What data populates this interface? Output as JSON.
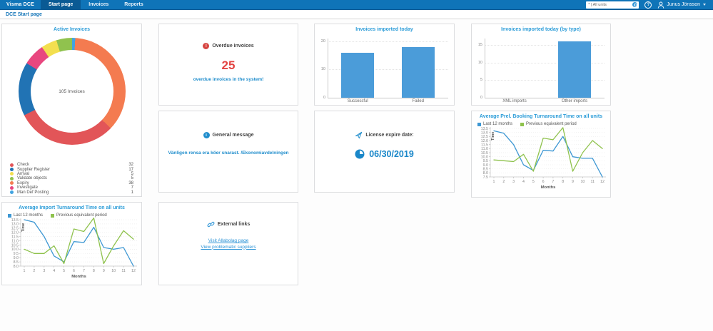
{
  "nav": {
    "brand": "Visma DCE",
    "items": [
      {
        "label": "Start page",
        "active": true
      },
      {
        "label": "Invoices",
        "active": false
      },
      {
        "label": "Reports",
        "active": false
      }
    ],
    "unit_selector": "* | All units",
    "user": "Junus Jönsson"
  },
  "breadcrumb": "DCE Start page",
  "cards": {
    "overdue": {
      "title": "Overdue invoices",
      "count": "25",
      "message": "overdue invoices in the system!"
    },
    "general_message": {
      "title": "General message",
      "message": "Vänligen rensa era köer snarast. /Ekonomiavdelningen"
    },
    "license": {
      "title": "License expire date:",
      "date": "06/30/2019"
    },
    "external_links": {
      "title": "External links",
      "links": [
        "Visit Allabolag page",
        "View problematic suppliers"
      ]
    }
  },
  "colors": {
    "navbar": "#0f74b8",
    "accent_blue": "#2b9cd8",
    "alert_red": "#e34543",
    "bar_fill": "#4b9cd9",
    "line_blue": "#3d97d3",
    "line_green": "#8fc24d"
  },
  "chart_data": [
    {
      "type": "pie",
      "title": "Active Invoices",
      "center_label": "105 Invoices",
      "total": 105,
      "segments": [
        {
          "label": "Check",
          "value": 32,
          "color": "#e25558"
        },
        {
          "label": "Supplier Register",
          "value": 17,
          "color": "#2173b4"
        },
        {
          "label": "Arrival",
          "value": 5,
          "color": "#f3df4f"
        },
        {
          "label": "Validate objects",
          "value": 5,
          "color": "#90c24e"
        },
        {
          "label": "Expiry",
          "value": 38,
          "color": "#f47b50"
        },
        {
          "label": "Investigate",
          "value": 7,
          "color": "#e8477f"
        },
        {
          "label": "Man Def Posting",
          "value": 1,
          "color": "#41a3e0"
        }
      ],
      "clockwise_order": [
        6,
        4,
        0,
        1,
        5,
        2,
        3
      ]
    },
    {
      "type": "bar",
      "title": "Invoices imported today",
      "categories": [
        "Successful",
        "Failed"
      ],
      "values": [
        16,
        18
      ],
      "y_ticks": [
        0,
        10,
        20
      ],
      "ylim": [
        0,
        21
      ]
    },
    {
      "type": "bar",
      "title": "Invoices imported today (by type)",
      "categories": [
        "XML imports",
        "Other imports"
      ],
      "values": [
        0,
        16
      ],
      "y_ticks": [
        0,
        5,
        10,
        15
      ],
      "ylim": [
        0,
        16.8
      ]
    },
    {
      "type": "line",
      "title": "Average Prel. Booking Turnaround Time on all units",
      "xlabel": "Months",
      "ylabel": "Time",
      "x": [
        1,
        2,
        3,
        4,
        5,
        6,
        7,
        8,
        9,
        10,
        11,
        12
      ],
      "y_ticks": [
        7.5,
        8.0,
        8.5,
        9.0,
        9.5,
        10.0,
        10.5,
        11.0,
        11.5,
        12.0,
        12.5,
        13.0,
        13.5
      ],
      "ylim": [
        7.5,
        13.5
      ],
      "series": [
        {
          "name": "Last 12 months",
          "color": "#3d97d3",
          "values": [
            13.2,
            12.9,
            11.5,
            9.0,
            8.3,
            10.8,
            10.7,
            12.5,
            10.0,
            9.8,
            9.8,
            7.5
          ]
        },
        {
          "name": "Previous equivalent period",
          "color": "#8fc24d",
          "values": [
            9.6,
            9.5,
            9.4,
            10.3,
            8.2,
            12.3,
            12.1,
            13.6,
            8.2,
            10.5,
            12.0,
            11.0
          ]
        }
      ]
    },
    {
      "type": "line",
      "title": "Average Import Turnaround Time on all units",
      "xlabel": "Months",
      "ylabel": "Time",
      "x": [
        1,
        2,
        3,
        4,
        5,
        6,
        7,
        8,
        9,
        10,
        11,
        12
      ],
      "y_ticks": [
        8.0,
        8.5,
        9.0,
        9.5,
        10.0,
        10.5,
        11.0,
        11.5,
        12.0,
        12.5,
        13.0,
        13.5
      ],
      "ylim": [
        8.0,
        13.5
      ],
      "series": [
        {
          "name": "Last 12 months",
          "color": "#3d97d3",
          "values": [
            13.5,
            13.2,
            11.5,
            9.2,
            8.5,
            10.9,
            10.8,
            12.6,
            10.2,
            10.0,
            10.2,
            8.0
          ]
        },
        {
          "name": "Previous equivalent period",
          "color": "#8fc24d",
          "values": [
            10.0,
            9.5,
            9.5,
            10.4,
            8.3,
            12.4,
            12.1,
            13.7,
            8.3,
            10.4,
            12.2,
            11.2
          ]
        }
      ]
    }
  ]
}
